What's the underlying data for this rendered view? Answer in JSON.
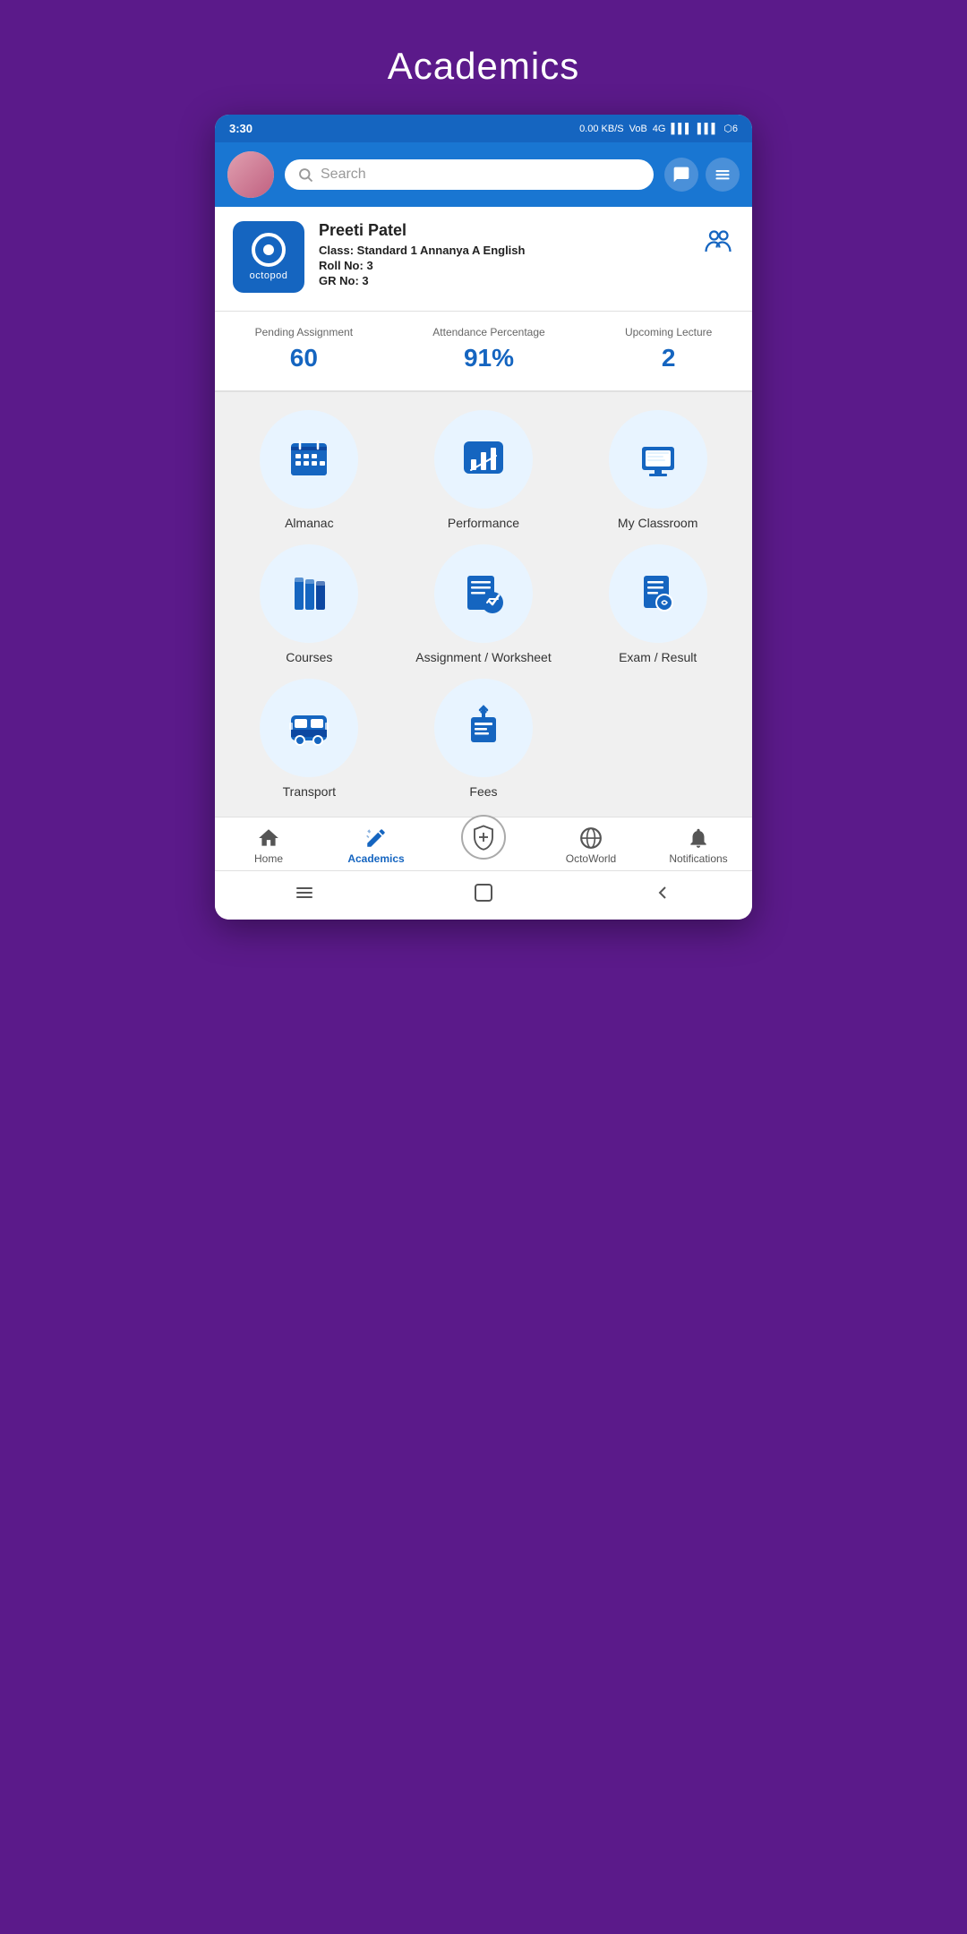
{
  "page": {
    "title": "Academics"
  },
  "statusBar": {
    "time": "3:30",
    "rightInfo": "0.00 KB/S  VoB  4G  ▌▌▌  ▌▌▌  🔋"
  },
  "header": {
    "searchPlaceholder": "Search",
    "searchLabel": "0 Search"
  },
  "profile": {
    "name": "Preeti Patel",
    "classLabel": "Class:",
    "classValue": "Standard 1 Annanya A English",
    "rollLabel": "Roll No:",
    "rollValue": "3",
    "grLabel": "GR No:",
    "grValue": "3",
    "logoText": "octopod"
  },
  "stats": [
    {
      "label": "Pending Assignment",
      "value": "60"
    },
    {
      "label": "Attendance Percentage",
      "value": "91%"
    },
    {
      "label": "Upcoming Lecture",
      "value": "2"
    }
  ],
  "gridItems": [
    {
      "id": "almanac",
      "label": "Almanac"
    },
    {
      "id": "performance",
      "label": "Performance"
    },
    {
      "id": "my-classroom",
      "label": "My Classroom"
    },
    {
      "id": "courses",
      "label": "Courses"
    },
    {
      "id": "assignment-worksheet",
      "label": "Assignment / Worksheet"
    },
    {
      "id": "exam-result",
      "label": "Exam / Result"
    },
    {
      "id": "transport",
      "label": "Transport"
    },
    {
      "id": "fees",
      "label": "Fees"
    }
  ],
  "bottomNav": [
    {
      "id": "home",
      "label": "Home",
      "active": false
    },
    {
      "id": "academics",
      "label": "Academics",
      "active": true
    },
    {
      "id": "octoworld-center",
      "label": "",
      "active": false
    },
    {
      "id": "octoworld",
      "label": "OctoWorld",
      "active": false
    },
    {
      "id": "notifications",
      "label": "Notifications",
      "active": false
    }
  ],
  "colors": {
    "primary": "#1565c0",
    "accent": "#5b1a8a",
    "iconBg": "#e8f4ff"
  }
}
